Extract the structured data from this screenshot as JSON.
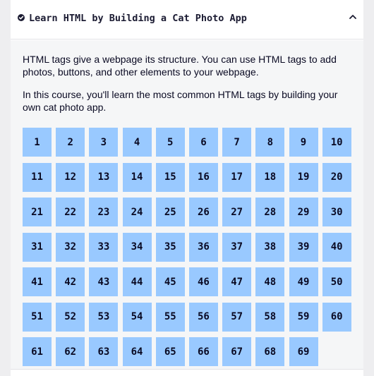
{
  "header": {
    "title": "Learn HTML by Building a Cat Photo App",
    "status_icon": "check-circle-icon",
    "toggle_icon": "chevron-up-icon"
  },
  "intro": {
    "paragraph_1": "HTML tags give a webpage its structure. You can use HTML tags to add photos, buttons, and other elements to your webpage.",
    "paragraph_2": "In this course, you'll learn the most common HTML tags by building your own cat photo app."
  },
  "steps": [
    "1",
    "2",
    "3",
    "4",
    "5",
    "6",
    "7",
    "8",
    "9",
    "10",
    "11",
    "12",
    "13",
    "14",
    "15",
    "16",
    "17",
    "18",
    "19",
    "20",
    "21",
    "22",
    "23",
    "24",
    "25",
    "26",
    "27",
    "28",
    "29",
    "30",
    "31",
    "32",
    "33",
    "34",
    "35",
    "36",
    "37",
    "38",
    "39",
    "40",
    "41",
    "42",
    "43",
    "44",
    "45",
    "46",
    "47",
    "48",
    "49",
    "50",
    "51",
    "52",
    "53",
    "54",
    "55",
    "56",
    "57",
    "58",
    "59",
    "60",
    "61",
    "62",
    "63",
    "64",
    "65",
    "66",
    "67",
    "68",
    "69"
  ],
  "colors": {
    "step_background": "#99c9ff",
    "text": "#0a0a23",
    "panel_background": "#f5f6f7",
    "page_background": "#eeeef0"
  }
}
